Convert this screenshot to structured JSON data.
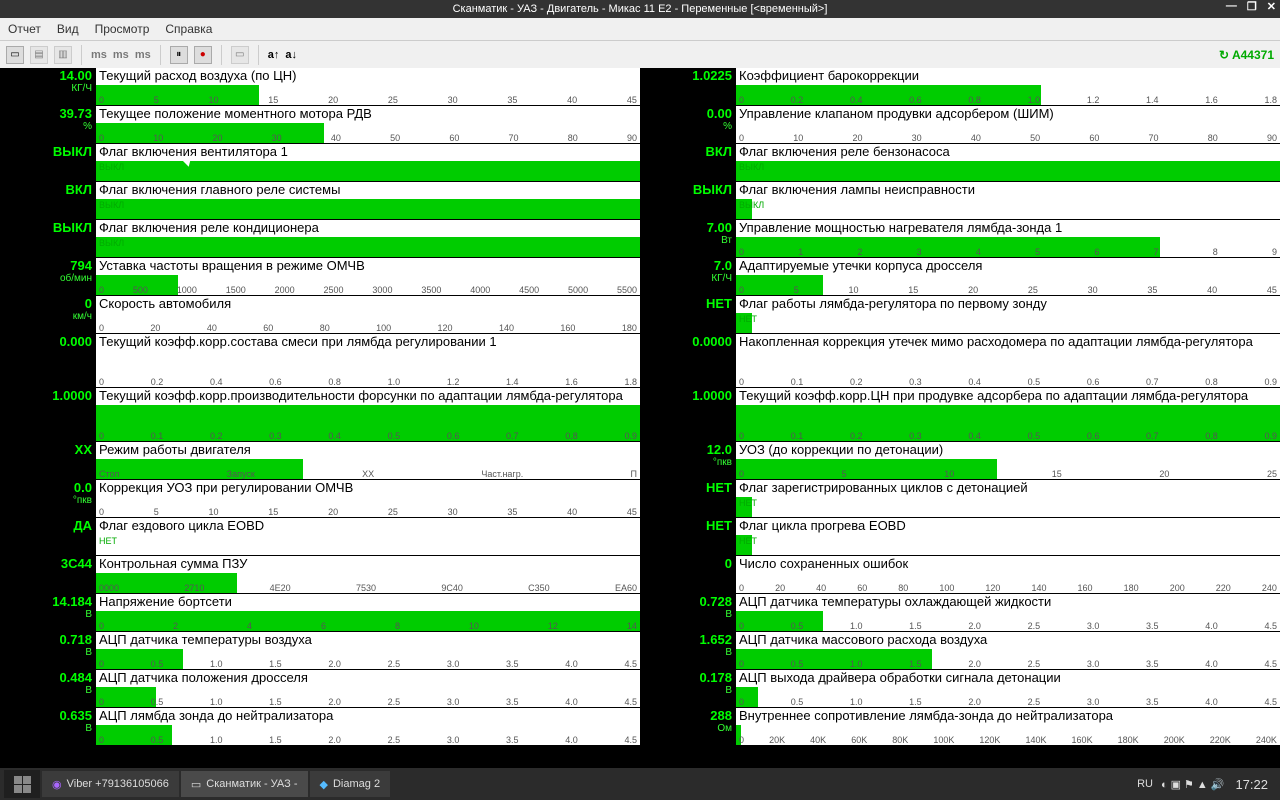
{
  "title": "Сканматик - УАЗ - Двигатель - Микас 11 Е2 - Переменные [<временный>]",
  "win_ctrls": {
    "min": "—",
    "max": "❐",
    "close": "✕"
  },
  "menu": [
    "Отчет",
    "Вид",
    "Просмотр",
    "Справка"
  ],
  "sess_id": "A44371",
  "tool_txt": {
    "a_inc": "a↑",
    "a_dec": "a↓"
  },
  "left": [
    {
      "v": "14.00",
      "u": "КГ/Ч",
      "l": "Текущий расход воздуха (по ЦН)",
      "p": 30,
      "s": [
        "0",
        "5",
        "10",
        "15",
        "20",
        "25",
        "30",
        "35",
        "40",
        "45"
      ]
    },
    {
      "v": "39.73",
      "u": "%",
      "l": "Текущее положение моментного мотора РДВ",
      "p": 42,
      "s": [
        "0",
        "10",
        "20",
        "30",
        "40",
        "50",
        "60",
        "70",
        "80",
        "90"
      ]
    },
    {
      "v": "ВЫКЛ",
      "u": "",
      "l": "Флаг включения вентилятора 1",
      "p": 100,
      "st": "ВЫКЛ"
    },
    {
      "v": "ВКЛ",
      "u": "",
      "l": "Флаг включения главного реле системы",
      "p": 100,
      "st": "ВЫКЛ"
    },
    {
      "v": "ВЫКЛ",
      "u": "",
      "l": "Флаг включения реле кондиционера",
      "p": 100,
      "st": "ВЫКЛ"
    },
    {
      "v": "794",
      "u": "об/мин",
      "l": "Уставка частоты вращения в режиме ОМЧВ",
      "p": 15,
      "s": [
        "0",
        "500",
        "1000",
        "1500",
        "2000",
        "2500",
        "3000",
        "3500",
        "4000",
        "4500",
        "5000",
        "5500"
      ]
    },
    {
      "v": "0",
      "u": "км/ч",
      "l": "Скорость автомобиля",
      "p": 0,
      "s": [
        "0",
        "20",
        "40",
        "60",
        "80",
        "100",
        "120",
        "140",
        "160",
        "180"
      ]
    },
    {
      "v": "0.000",
      "u": "",
      "l": "Текущий коэфф.корр.состава смеси при лямбда регулировании 1",
      "p": 0,
      "s": [
        "0",
        "0.2",
        "0.4",
        "0.6",
        "0.8",
        "1.0",
        "1.2",
        "1.4",
        "1.6",
        "1.8"
      ],
      "tall": true
    },
    {
      "v": "1.0000",
      "u": "",
      "l": "Текущий коэфф.корр.производительности форсунки по адаптации лямбда-регулятора",
      "p": 100,
      "s": [
        "0",
        "0.1",
        "0.2",
        "0.3",
        "0.4",
        "0.5",
        "0.6",
        "0.7",
        "0.8",
        "0.9"
      ],
      "tall": true
    },
    {
      "v": "ХХ",
      "u": "",
      "l": "Режим работы двигателя",
      "p": 38,
      "s": [
        "Стоп",
        "Запуск",
        "ХХ",
        "Част.нагр.",
        "П"
      ]
    },
    {
      "v": "0.0",
      "u": "°пкв",
      "l": "Коррекция УОЗ при регулировании ОМЧВ",
      "p": 0,
      "s": [
        "0",
        "5",
        "10",
        "15",
        "20",
        "25",
        "30",
        "35",
        "40",
        "45"
      ]
    },
    {
      "v": "ДА",
      "u": "",
      "l": "Флаг ездового цикла EOBD",
      "p": 0,
      "st": "НЕТ"
    },
    {
      "v": "3C44",
      "u": "",
      "l": "Контрольная сумма ПЗУ",
      "p": 26,
      "s": [
        "0000",
        "2710",
        "4E20",
        "7530",
        "9C40",
        "C350",
        "EA60"
      ]
    },
    {
      "v": "14.184",
      "u": "В",
      "l": "Напряжение бортсети",
      "p": 100,
      "s": [
        "0",
        "2",
        "4",
        "6",
        "8",
        "10",
        "12",
        "14"
      ]
    },
    {
      "v": "0.718",
      "u": "В",
      "l": "АЦП датчика температуры воздуха",
      "p": 16,
      "s": [
        "0",
        "0.5",
        "1.0",
        "1.5",
        "2.0",
        "2.5",
        "3.0",
        "3.5",
        "4.0",
        "4.5"
      ]
    },
    {
      "v": "0.484",
      "u": "В",
      "l": "АЦП датчика положения дросселя",
      "p": 11,
      "s": [
        "0",
        "0.5",
        "1.0",
        "1.5",
        "2.0",
        "2.5",
        "3.0",
        "3.5",
        "4.0",
        "4.5"
      ]
    },
    {
      "v": "0.635",
      "u": "В",
      "l": "АЦП лямбда зонда до нейтрализатора",
      "p": 14,
      "s": [
        "0",
        "0.5",
        "1.0",
        "1.5",
        "2.0",
        "2.5",
        "3.0",
        "3.5",
        "4.0",
        "4.5"
      ]
    }
  ],
  "right": [
    {
      "v": "1.0225",
      "u": "",
      "l": "Коэффициент барокоррекции",
      "p": 56,
      "s": [
        "0",
        "0.2",
        "0.4",
        "0.6",
        "0.8",
        "1.0",
        "1.2",
        "1.4",
        "1.6",
        "1.8"
      ]
    },
    {
      "v": "0.00",
      "u": "%",
      "l": "Управление клапаном продувки адсорбером (ШИМ)",
      "p": 0,
      "s": [
        "0",
        "10",
        "20",
        "30",
        "40",
        "50",
        "60",
        "70",
        "80",
        "90"
      ]
    },
    {
      "v": "ВКЛ",
      "u": "",
      "l": "Флаг включения реле бензонасоса",
      "p": 100,
      "st": "ВЫКЛ"
    },
    {
      "v": "ВЫКЛ",
      "u": "",
      "l": "Флаг включения лампы неисправности",
      "p": 3,
      "st": "ВЫКЛ"
    },
    {
      "v": "7.00",
      "u": "Вт",
      "l": "Управление мощностью нагревателя лямбда-зонда 1",
      "p": 78,
      "s": [
        "0",
        "1",
        "2",
        "3",
        "4",
        "5",
        "6",
        "7",
        "8",
        "9"
      ]
    },
    {
      "v": "7.0",
      "u": "КГ/Ч",
      "l": "Адаптируемые утечки корпуса дросселя",
      "p": 16,
      "s": [
        "0",
        "5",
        "10",
        "15",
        "20",
        "25",
        "30",
        "35",
        "40",
        "45"
      ]
    },
    {
      "v": "НЕТ",
      "u": "",
      "l": "Флаг работы лямбда-регулятора по первому зонду",
      "p": 3,
      "st": "НЕТ"
    },
    {
      "v": "0.0000",
      "u": "",
      "l": "Накопленная коррекция утечек мимо расходомера по адаптации лямбда-регулятора",
      "p": 0,
      "s": [
        "0",
        "0.1",
        "0.2",
        "0.3",
        "0.4",
        "0.5",
        "0.6",
        "0.7",
        "0.8",
        "0.9"
      ],
      "tall": true
    },
    {
      "v": "1.0000",
      "u": "",
      "l": "Текущий коэфф.корр.ЦН при продувке адсорбера по адаптации лямбда-регулятора",
      "p": 100,
      "s": [
        "0",
        "0.1",
        "0.2",
        "0.3",
        "0.4",
        "0.5",
        "0.6",
        "0.7",
        "0.8",
        "0.9"
      ],
      "tall": true
    },
    {
      "v": "12.0",
      "u": "°пкв",
      "l": "УОЗ (до коррекции по детонации)",
      "p": 48,
      "s": [
        "0",
        "5",
        "10",
        "15",
        "20",
        "25"
      ]
    },
    {
      "v": "НЕТ",
      "u": "",
      "l": "Флаг зарегистрированных циклов с детонацией",
      "p": 3,
      "st": "НЕТ"
    },
    {
      "v": "НЕТ",
      "u": "",
      "l": "Флаг цикла прогрева EOBD",
      "p": 3,
      "st": "НЕТ"
    },
    {
      "v": "0",
      "u": "",
      "l": "Число сохраненных ошибок",
      "p": 0,
      "s": [
        "0",
        "20",
        "40",
        "60",
        "80",
        "100",
        "120",
        "140",
        "160",
        "180",
        "200",
        "220",
        "240"
      ]
    },
    {
      "v": "0.728",
      "u": "В",
      "l": "АЦП датчика температуры охлаждающей жидкости",
      "p": 16,
      "s": [
        "0",
        "0.5",
        "1.0",
        "1.5",
        "2.0",
        "2.5",
        "3.0",
        "3.5",
        "4.0",
        "4.5"
      ]
    },
    {
      "v": "1.652",
      "u": "В",
      "l": "АЦП датчика массового расхода воздуха",
      "p": 36,
      "s": [
        "0",
        "0.5",
        "1.0",
        "1.5",
        "2.0",
        "2.5",
        "3.0",
        "3.5",
        "4.0",
        "4.5"
      ]
    },
    {
      "v": "0.178",
      "u": "В",
      "l": "АЦП выхода драйвера обработки сигнала детонации",
      "p": 4,
      "s": [
        "0",
        "0.5",
        "1.0",
        "1.5",
        "2.0",
        "2.5",
        "3.0",
        "3.5",
        "4.0",
        "4.5"
      ]
    },
    {
      "v": "288",
      "u": "Ом",
      "l": "Внутреннее сопротивление лямбда-зонда до нейтрализатора",
      "p": 1,
      "s": [
        "0",
        "20K",
        "40K",
        "60K",
        "80K",
        "100K",
        "120K",
        "140K",
        "160K",
        "180K",
        "200K",
        "220K",
        "240K"
      ]
    }
  ],
  "taskbar": {
    "tasks": [
      "Viber +79136105066",
      "Сканматик - УАЗ -",
      "Diamag 2"
    ],
    "lang": "RU",
    "clock": "17:22"
  }
}
